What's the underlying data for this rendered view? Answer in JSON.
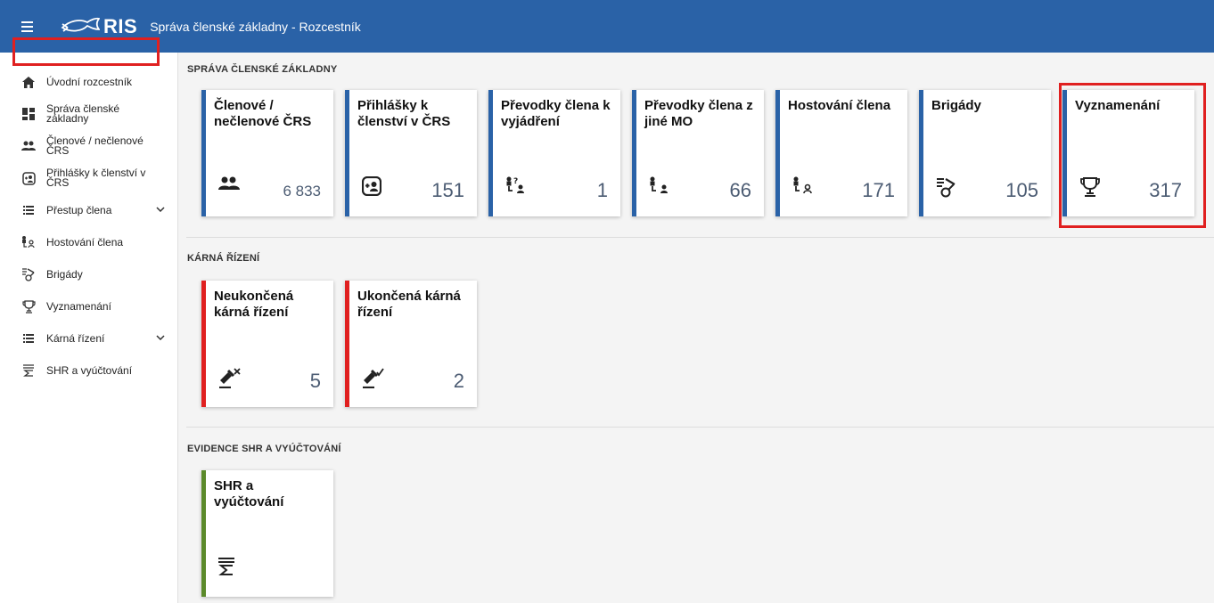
{
  "header": {
    "logo_text": "RIS",
    "title": "Správa členské základny - Rozcestník"
  },
  "sidebar": {
    "items": [
      {
        "label": "Úvodní rozcestník",
        "icon": "home-icon"
      },
      {
        "label": "Správa členské základny",
        "icon": "dashboard-icon"
      },
      {
        "label": "Členové / nečlenové ČRS",
        "icon": "people-icon"
      },
      {
        "label": "Přihlášky k členství v ČRS",
        "icon": "add-person-icon"
      },
      {
        "label": "Přestup člena",
        "icon": "list-icon"
      },
      {
        "label": "Hostování člena",
        "icon": "guest-icon"
      },
      {
        "label": "Brigády",
        "icon": "brigade-icon"
      },
      {
        "label": "Vyznamenání",
        "icon": "trophy-icon"
      },
      {
        "label": "Kárná řízení",
        "icon": "list-icon"
      },
      {
        "label": "SHR a vyúčtování",
        "icon": "sum-icon"
      }
    ]
  },
  "sections": {
    "membership": {
      "title": "SPRÁVA ČLENSKÉ ZÁKLADNY",
      "cards": [
        {
          "title": "Členové / nečlenové ČRS",
          "count": "6 833"
        },
        {
          "title": "Přihlášky k členství v ČRS",
          "count": "151"
        },
        {
          "title": "Převodky člena k vyjádření",
          "count": "1"
        },
        {
          "title": "Převodky člena z jiné MO",
          "count": "66"
        },
        {
          "title": "Hostování člena",
          "count": "171"
        },
        {
          "title": "Brigády",
          "count": "105"
        },
        {
          "title": "Vyznamenání",
          "count": "317"
        }
      ]
    },
    "disciplinary": {
      "title": "KÁRNÁ ŘÍZENÍ",
      "cards": [
        {
          "title": "Neukončená kárná řízení",
          "count": "5"
        },
        {
          "title": "Ukončená kárná řízení",
          "count": "2"
        }
      ]
    },
    "shr": {
      "title": "EVIDENCE SHR A VYÚČTOVÁNÍ",
      "cards": [
        {
          "title": "SHR a vyúčtování"
        }
      ]
    }
  },
  "colors": {
    "primary": "#2a62a7",
    "danger": "#e02020",
    "success": "#5b8a2a",
    "highlight": "#e02020"
  }
}
